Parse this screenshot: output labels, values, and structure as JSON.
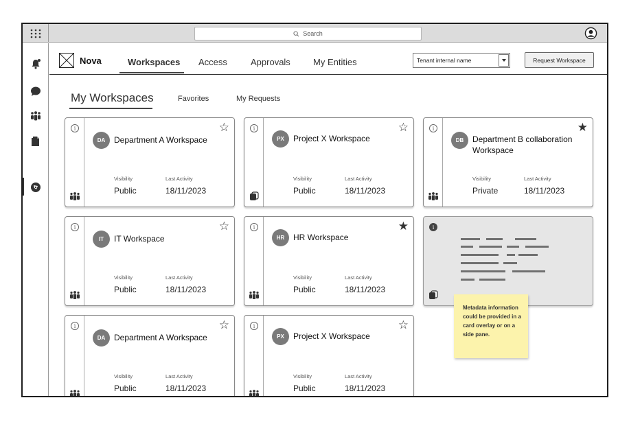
{
  "topbar": {
    "apps_icon": "apps-grid-icon",
    "search_placeholder": "Search",
    "profile_icon": "user-profile-icon"
  },
  "rail": {
    "items": [
      "notification-bell-icon",
      "chat-bubble-icon",
      "teams-icon",
      "documents-icon",
      "explore-icon"
    ],
    "active": "explore-icon"
  },
  "header": {
    "brand": "Nova",
    "nav": [
      {
        "label": "Workspaces",
        "active": true
      },
      {
        "label": "Access",
        "active": false
      },
      {
        "label": "Approvals",
        "active": false
      },
      {
        "label": "My Entities",
        "active": false
      }
    ],
    "tenant_select": "Tenant internal name",
    "request_button": "Request Workspace"
  },
  "subtabs": {
    "my_workspaces": "My Workspaces",
    "favorites": "Favorites",
    "my_requests": "My Requests"
  },
  "labels": {
    "visibility": "Visibility",
    "last_activity": "Last Activity"
  },
  "cards": [
    {
      "initials": "DA",
      "title": "Department A Workspace",
      "visibility": "Public",
      "last_activity": "18/11/2023",
      "favorite": false,
      "icon": "teams-icon"
    },
    {
      "initials": "PX",
      "title": "Project X Workspace",
      "visibility": "Public",
      "last_activity": "18/11/2023",
      "favorite": false,
      "icon": "copy-pages-icon"
    },
    {
      "initials": "DB",
      "title": "Department B collaboration Workspace",
      "visibility": "Private",
      "last_activity": "18/11/2023",
      "favorite": true,
      "icon": "teams-icon"
    },
    {
      "initials": "IT",
      "title": "IT Workspace",
      "visibility": "Public",
      "last_activity": "18/11/2023",
      "favorite": false,
      "icon": "teams-icon"
    },
    {
      "initials": "HR",
      "title": "HR Workspace",
      "visibility": "Public",
      "last_activity": "18/11/2023",
      "favorite": true,
      "icon": "teams-icon"
    },
    {
      "initials": "DA",
      "title": "Department A Workspace",
      "visibility": "Public",
      "last_activity": "18/11/2023",
      "favorite": false,
      "icon": "teams-icon"
    },
    {
      "initials": "PX",
      "title": "Project X Workspace",
      "visibility": "Public",
      "last_activity": "18/11/2023",
      "favorite": false,
      "icon": "teams-icon"
    }
  ],
  "note": "Metadata information could be provided in a card overlay or on a side pane."
}
